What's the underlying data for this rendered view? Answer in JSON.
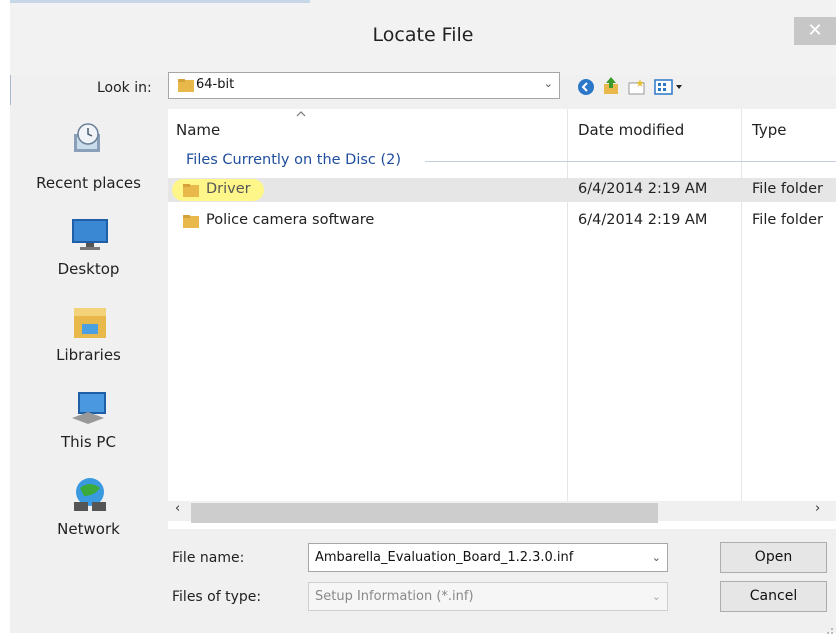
{
  "dialog": {
    "title": "Locate File",
    "close_glyph": "✕"
  },
  "lookin": {
    "label": "Look in:",
    "value": "64-bit"
  },
  "toolbar": {
    "icons": [
      "back-icon",
      "up-folder-icon",
      "new-folder-icon",
      "view-menu-icon"
    ]
  },
  "places": [
    {
      "label": "Recent places",
      "icon": "recent-places-icon"
    },
    {
      "label": "Desktop",
      "icon": "desktop-icon"
    },
    {
      "label": "Libraries",
      "icon": "libraries-icon"
    },
    {
      "label": "This PC",
      "icon": "this-pc-icon"
    },
    {
      "label": "Network",
      "icon": "network-icon"
    }
  ],
  "columns": {
    "name": "Name",
    "date": "Date modified",
    "type": "Type"
  },
  "group": {
    "label": "Files Currently on the Disc (2)"
  },
  "rows": [
    {
      "name": "Driver",
      "date": "6/4/2014 2:19 AM",
      "type": "File folder"
    },
    {
      "name": "Police camera software",
      "date": "6/4/2014 2:19 AM",
      "type": "File folder"
    }
  ],
  "filename": {
    "label": "File name:",
    "value": "Ambarella_Evaluation_Board_1.2.3.0.inf"
  },
  "filetype": {
    "label": "Files of type:",
    "value": "Setup Information (*.inf)"
  },
  "buttons": {
    "open": "Open",
    "cancel": "Cancel"
  },
  "colors": {
    "highlight": "#fff68a",
    "group_text": "#1f4e9e",
    "folder": "#e8b84a"
  }
}
